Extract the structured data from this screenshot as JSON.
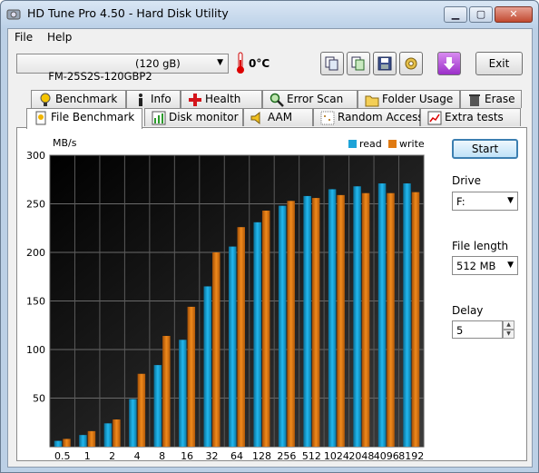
{
  "window": {
    "title": "HD Tune Pro 4.50 - Hard Disk Utility",
    "controls": {
      "minimize": "▁",
      "maximize": "▢",
      "close": "✕"
    }
  },
  "menu": {
    "file": "File",
    "help": "Help"
  },
  "toolbar": {
    "drive_name": "FM-25S2S-120GBP2",
    "drive_size": "(120 gB)",
    "temperature": "0°C",
    "buttons": [
      "copy-icon",
      "copy-info-icon",
      "save-icon",
      "options-icon",
      "download-icon"
    ],
    "exit_label": "Exit"
  },
  "tabs": {
    "top": [
      {
        "label": "Benchmark",
        "icon": "benchmark-icon"
      },
      {
        "label": "Info",
        "icon": "info-icon"
      },
      {
        "label": "Health",
        "icon": "health-icon"
      },
      {
        "label": "Error Scan",
        "icon": "error-scan-icon"
      },
      {
        "label": "Folder Usage",
        "icon": "folder-icon"
      },
      {
        "label": "Erase",
        "icon": "trash-icon"
      }
    ],
    "bottom": [
      {
        "label": "File Benchmark",
        "icon": "file-benchmark-icon",
        "active": true
      },
      {
        "label": "Disk monitor",
        "icon": "disk-monitor-icon"
      },
      {
        "label": "AAM",
        "icon": "speaker-icon"
      },
      {
        "label": "Random Access",
        "icon": "random-access-icon"
      },
      {
        "label": "Extra tests",
        "icon": "extra-tests-icon"
      }
    ]
  },
  "controls": {
    "start_label": "Start",
    "drive_label": "Drive",
    "drive_value": "F:",
    "file_length_label": "File length",
    "file_length_value": "512 MB",
    "delay_label": "Delay",
    "delay_value": "5"
  },
  "chart_data": {
    "type": "bar",
    "ylabel": "MB/s",
    "ylim": [
      0,
      300
    ],
    "yticks": [
      50,
      100,
      150,
      200,
      250,
      300
    ],
    "categories": [
      "0.5",
      "1",
      "2",
      "4",
      "8",
      "16",
      "32",
      "64",
      "128",
      "256",
      "512",
      "1024",
      "2048",
      "4096",
      "8192"
    ],
    "series": [
      {
        "name": "read",
        "color": "#1da3d8",
        "values": [
          6,
          12,
          24,
          49,
          84,
          110,
          165,
          206,
          231,
          248,
          258,
          265,
          268,
          271,
          271
        ]
      },
      {
        "name": "write",
        "color": "#e07a12",
        "values": [
          8,
          16,
          28,
          75,
          114,
          144,
          200,
          226,
          243,
          253,
          256,
          259,
          261,
          261,
          262
        ]
      }
    ],
    "grid": true,
    "legend": "top-right"
  }
}
